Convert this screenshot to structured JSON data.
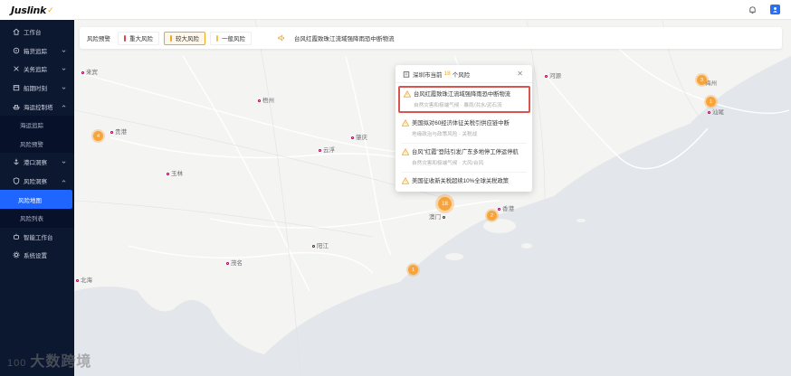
{
  "app": {
    "logo_text": "Juslink"
  },
  "sidebar": {
    "items": [
      {
        "label": "工作台",
        "icon": "home-icon",
        "expand": false
      },
      {
        "label": "箱货追踪",
        "icon": "tracking-icon",
        "expand": true
      },
      {
        "label": "关务追踪",
        "icon": "customs-icon",
        "expand": true
      },
      {
        "label": "船期时刻",
        "icon": "calendar-icon",
        "expand": true
      },
      {
        "label": "海运控制塔",
        "icon": "ship-icon",
        "expand": true
      }
    ],
    "sea_subs": [
      {
        "label": "海运追踪"
      },
      {
        "label": "风险预警"
      }
    ],
    "items2": [
      {
        "label": "港口洞察",
        "icon": "port-icon",
        "expand": true
      },
      {
        "label": "风险洞察",
        "icon": "shield-icon",
        "expand": true
      }
    ],
    "risk_subs": [
      {
        "label": "风险地图",
        "active": true
      },
      {
        "label": "风险列表",
        "active": false
      }
    ],
    "items3": [
      {
        "label": "智能工作台",
        "icon": "robot-icon"
      },
      {
        "label": "系统设置",
        "icon": "gear-icon"
      }
    ]
  },
  "riskbar": {
    "title": "风险预警",
    "chips": [
      {
        "label": "重大风险",
        "color": "#e04646",
        "active": false
      },
      {
        "label": "较大风险",
        "color": "#f0a623",
        "active": true
      },
      {
        "label": "一般风险",
        "color": "#f5c242",
        "active": false
      }
    ],
    "ticker": "台风红霞致珠江流域强降雨恐中断物流"
  },
  "popup": {
    "prefix": "深圳市当前",
    "count": "18",
    "suffix": "个风险",
    "items": [
      {
        "title": "台风红霞致珠江流域强降雨恐中断物流",
        "subtitle": "自然灾害和极端气候 · 暴雨/洪水/泥石流",
        "highlight": true
      },
      {
        "title": "美国拟对60经济体征关税引供应链中断",
        "subtitle": "地缘政治与政策风险 · 关税战",
        "highlight": false
      },
      {
        "title": "台风\"红霞\"登陆引发广东多地停工停运停航",
        "subtitle": "自然灾害和极端气候 · 大风/台风",
        "highlight": false
      },
      {
        "title": "美国征收新关税超续10%全球关税政策",
        "subtitle": "",
        "highlight": false
      }
    ]
  },
  "map": {
    "cities": [
      {
        "name": "来宾"
      },
      {
        "name": "贵港"
      },
      {
        "name": "梧州"
      },
      {
        "name": "肇庆"
      },
      {
        "name": "云浮"
      },
      {
        "name": "玉林"
      },
      {
        "name": "阳江"
      },
      {
        "name": "茂名"
      },
      {
        "name": "北海"
      },
      {
        "name": "澳门"
      },
      {
        "name": "香港"
      },
      {
        "name": "河源"
      },
      {
        "name": "梅州"
      },
      {
        "name": "汕尾"
      }
    ],
    "markers": [
      "4",
      "18",
      "2",
      "1",
      "3",
      "1"
    ]
  },
  "watermark": {
    "left": "100",
    "right": "大数跨境"
  }
}
